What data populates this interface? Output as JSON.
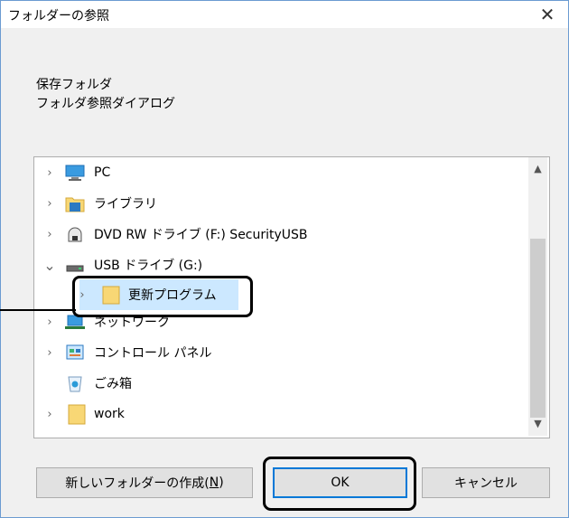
{
  "dialog": {
    "title": "フォルダーの参照",
    "close_glyph": "✕",
    "description_line1": "保存フォルダ",
    "description_line2": "フォルダ参照ダイアログ"
  },
  "tree": {
    "items": [
      {
        "label": "PC",
        "icon": "pc-icon",
        "expander": "collapsed"
      },
      {
        "label": "ライブラリ",
        "icon": "library-icon",
        "expander": "collapsed"
      },
      {
        "label": "DVD RW ドライブ (F:) SecurityUSB",
        "icon": "dvd-drive-icon",
        "expander": "collapsed"
      },
      {
        "label": "USB ドライブ (G:)",
        "icon": "usb-drive-icon",
        "expander": "expanded"
      },
      {
        "label": "更新プログラム",
        "icon": "folder-icon",
        "expander": "collapsed",
        "selected": true
      },
      {
        "label": "ネットワーク",
        "icon": "network-icon",
        "expander": "collapsed"
      },
      {
        "label": "コントロール パネル",
        "icon": "control-panel-icon",
        "expander": "collapsed"
      },
      {
        "label": "ごみ箱",
        "icon": "recycle-bin-icon",
        "expander": "none"
      },
      {
        "label": "work",
        "icon": "folder-icon",
        "expander": "collapsed"
      }
    ],
    "chevron_right": "›",
    "chevron_down": "⌄"
  },
  "buttons": {
    "new_folder_text": "新しいフォルダーの作成(",
    "new_folder_key": "N",
    "new_folder_end": ")",
    "ok": "OK",
    "cancel": "キャンセル"
  },
  "colors": {
    "selection": "#cce8ff",
    "focus_border": "#0078d7",
    "folder": "#f8d775"
  }
}
